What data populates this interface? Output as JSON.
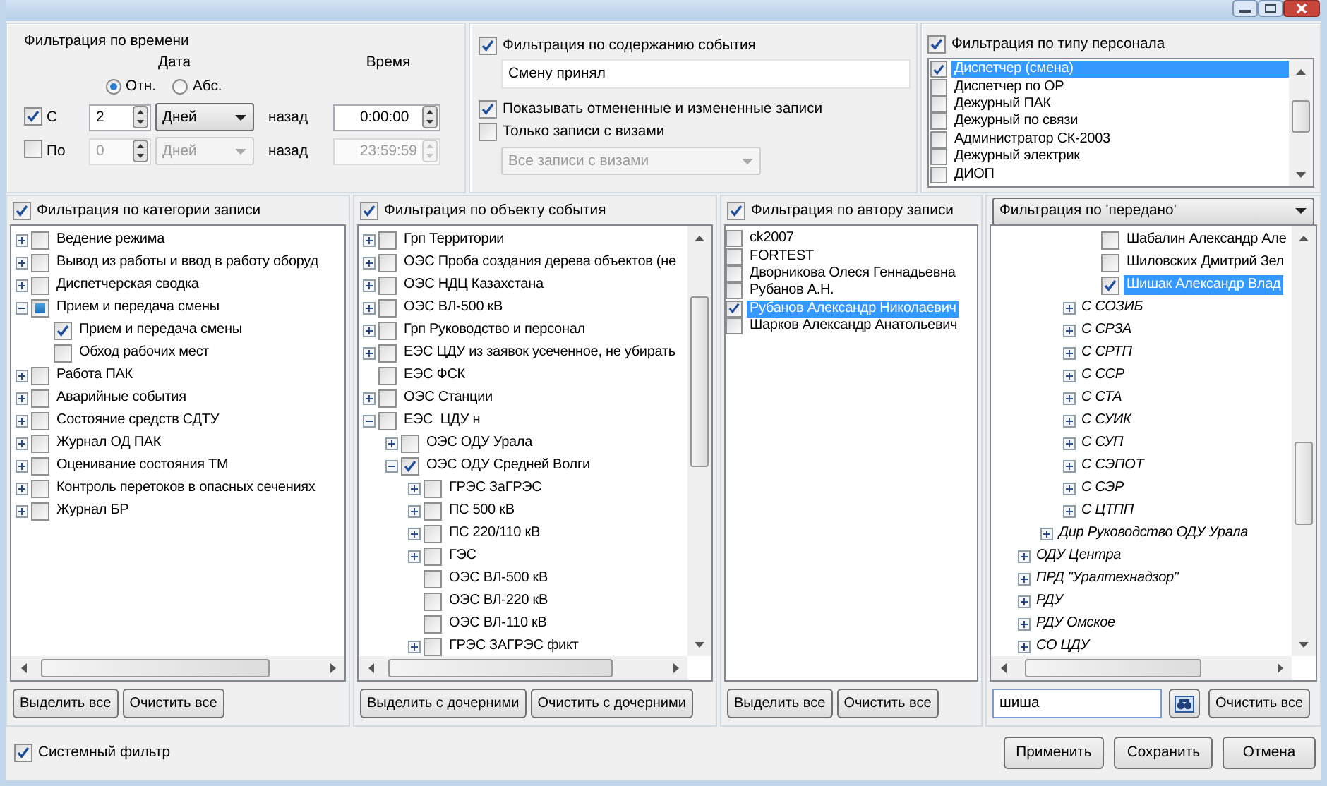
{
  "time_filter": {
    "title": "Фильтрация по времени",
    "date_heading": "Дата",
    "time_heading": "Время",
    "modes": [
      {
        "label": "Отн.",
        "selected": true
      },
      {
        "label": "Абс.",
        "selected": false
      }
    ],
    "rows": [
      {
        "label": "С",
        "checked": true,
        "count": "2",
        "unit": "Дней",
        "suffix": "назад",
        "time": "0:00:00",
        "disabled": false
      },
      {
        "label": "По",
        "checked": false,
        "count": "0",
        "unit": "Дней",
        "suffix": "назад",
        "time": "23:59:59",
        "disabled": true
      }
    ]
  },
  "content_filter": {
    "label": "Фильтрация по содержанию события",
    "checked": true,
    "text": "Смену принял",
    "options": [
      {
        "label": "Показывать отмененные и измененные записи",
        "checked": true
      },
      {
        "label": "Только записи с визами",
        "checked": false
      }
    ],
    "visa_select": {
      "value": "Все записи с визами",
      "disabled": true
    }
  },
  "personnel_filter": {
    "label": "Фильтрация по типу персонала",
    "checked": true,
    "items": [
      {
        "label": "Диспетчер (смена)",
        "checked": true,
        "selected": true
      },
      {
        "label": "Диспетчер по ОР",
        "checked": false,
        "selected": false
      },
      {
        "label": "Дежурный ПАК",
        "checked": false,
        "selected": false
      },
      {
        "label": "Дежурный по связи",
        "checked": false,
        "selected": false
      },
      {
        "label": "Администратор СК-2003",
        "checked": false,
        "selected": false
      },
      {
        "label": "Дежурный электрик",
        "checked": false,
        "selected": false
      },
      {
        "label": "ДИОП",
        "checked": false,
        "selected": false
      }
    ]
  },
  "panels": [
    {
      "kind": "tree",
      "label": "Фильтрация по категории записи",
      "checked": true,
      "nodes": [
        {
          "label": "Ведение режима",
          "kind": "branch",
          "expanded": false,
          "checked": false,
          "partial": false
        },
        {
          "label": "Вывод из работы и ввод в работу оборуд",
          "kind": "branch",
          "expanded": false,
          "checked": false,
          "partial": false
        },
        {
          "label": "Диспетчерская сводка",
          "kind": "branch",
          "expanded": false,
          "checked": false,
          "partial": false
        },
        {
          "label": "Прием и передача смены",
          "kind": "branch",
          "expanded": true,
          "checked": false,
          "partial": true,
          "children": [
            {
              "label": "Прием и передача смены",
              "kind": "leaf",
              "checked": true,
              "partial": false
            },
            {
              "label": "Обход рабочих мест",
              "kind": "leaf",
              "checked": false,
              "partial": false
            }
          ]
        },
        {
          "label": "Работа ПАК",
          "kind": "branch",
          "expanded": false,
          "checked": false,
          "partial": false
        },
        {
          "label": "Аварийные события",
          "kind": "branch",
          "expanded": false,
          "checked": false,
          "partial": false
        },
        {
          "label": "Состояние средств СДТУ",
          "kind": "branch",
          "expanded": false,
          "checked": false,
          "partial": false
        },
        {
          "label": "Журнал ОД ПАК",
          "kind": "branch",
          "expanded": false,
          "checked": false,
          "partial": false
        },
        {
          "label": "Оценивание состояния ТМ",
          "kind": "branch",
          "expanded": false,
          "checked": false,
          "partial": false
        },
        {
          "label": "Контроль перетоков в опасных сечениях",
          "kind": "branch",
          "expanded": false,
          "checked": false,
          "partial": false
        },
        {
          "label": "Журнал БР",
          "kind": "branch",
          "expanded": false,
          "checked": false,
          "partial": false
        }
      ],
      "buttons": [
        "Выделить все",
        "Очистить все"
      ]
    },
    {
      "kind": "tree",
      "label": "Фильтрация по объекту события",
      "checked": true,
      "nodes": [
        {
          "label": "Грп Территории",
          "kind": "branch",
          "expanded": false,
          "checked": false,
          "partial": false
        },
        {
          "label": "ОЭС Проба создания дерева объектов (не",
          "kind": "branch",
          "expanded": false,
          "checked": false,
          "partial": false
        },
        {
          "label": "ОЭС НДЦ Казахстана",
          "kind": "branch",
          "expanded": false,
          "checked": false,
          "partial": false
        },
        {
          "label": "ОЭС ВЛ-500 кВ",
          "kind": "branch",
          "expanded": false,
          "checked": false,
          "partial": false
        },
        {
          "label": "Грп Руководство и персонал",
          "kind": "branch",
          "expanded": false,
          "checked": false,
          "partial": false
        },
        {
          "label": "ЕЭС ЦДУ из заявок усеченное, не убирать",
          "kind": "branch",
          "expanded": false,
          "checked": false,
          "partial": false
        },
        {
          "label": "ЕЭС ФСК",
          "kind": "leaf",
          "checked": false,
          "partial": false
        },
        {
          "label": "ОЭС Станции",
          "kind": "branch",
          "expanded": false,
          "checked": false,
          "partial": false
        },
        {
          "label": "ЕЭС  ЦДУ н",
          "kind": "branch",
          "expanded": true,
          "checked": false,
          "partial": false,
          "children": [
            {
              "label": "ОЭС ОДУ Урала",
              "kind": "branch",
              "expanded": false,
              "checked": false,
              "partial": false
            },
            {
              "label": "ОЭС ОДУ Средней Волги",
              "kind": "branch",
              "expanded": true,
              "checked": true,
              "partial": false,
              "children": [
                {
                  "label": "ГРЭС ЗаГРЭС",
                  "kind": "branch",
                  "expanded": false,
                  "checked": false,
                  "partial": false
                },
                {
                  "label": "ПС 500 кВ",
                  "kind": "branch",
                  "expanded": false,
                  "checked": false,
                  "partial": false
                },
                {
                  "label": "ПС 220/110 кВ",
                  "kind": "branch",
                  "expanded": false,
                  "checked": false,
                  "partial": false
                },
                {
                  "label": "ГЭС",
                  "kind": "branch",
                  "expanded": false,
                  "checked": false,
                  "partial": false
                },
                {
                  "label": "ОЭС ВЛ-500 кВ",
                  "kind": "leaf",
                  "checked": false,
                  "partial": false
                },
                {
                  "label": "ОЭС ВЛ-220 кВ",
                  "kind": "leaf",
                  "checked": false,
                  "partial": false
                },
                {
                  "label": "ОЭС ВЛ-110 кВ",
                  "kind": "leaf",
                  "checked": false,
                  "partial": false
                },
                {
                  "label": "ГРЭС ЗАГРЭС фикт",
                  "kind": "branch",
                  "expanded": false,
                  "checked": false,
                  "partial": false
                }
              ]
            }
          ]
        }
      ],
      "buttons": [
        "Выделить с дочерними",
        "Очистить с дочерними"
      ]
    },
    {
      "kind": "list",
      "label": "Фильтрация по автору записи",
      "checked": true,
      "items": [
        {
          "label": "ck2007",
          "checked": false,
          "selected": false
        },
        {
          "label": "FORTEST",
          "checked": false,
          "selected": false
        },
        {
          "label": "Дворникова Олеся Геннадьевна",
          "checked": false,
          "selected": false
        },
        {
          "label": "Рубанов А.Н.",
          "checked": false,
          "selected": false
        },
        {
          "label": "Рубанов Александр Николаевич",
          "checked": true,
          "selected": true
        },
        {
          "label": "Шарков Александр Анатольевич",
          "checked": false,
          "selected": false
        }
      ],
      "buttons": [
        "Выделить все",
        "Очистить все"
      ]
    },
    {
      "kind": "tree",
      "selector": "Фильтрация по 'передано'",
      "nodes": [
        {
          "kind": "continued",
          "children": [
            {
              "kind": "continued",
              "children": [
                {
                  "kind": "continued",
                  "children": [
                    {
                      "kind": "continued",
                      "children": [
                        {
                          "label": "Шабалин Александр Але",
                          "kind": "leaf",
                          "checked": false,
                          "partial": false,
                          "selected": false
                        },
                        {
                          "label": "Шиловских Дмитрий Зел",
                          "kind": "leaf",
                          "checked": false,
                          "partial": false,
                          "selected": false
                        },
                        {
                          "label": "Шишак Александр Влад",
                          "kind": "leaf",
                          "checked": true,
                          "partial": false,
                          "selected": true
                        }
                      ]
                    },
                    {
                      "label": "С СОЗИБ",
                      "kind": "branch",
                      "expanded": false
                    },
                    {
                      "label": "С СРЗА",
                      "kind": "branch",
                      "expanded": false
                    },
                    {
                      "label": "С СРТП",
                      "kind": "branch",
                      "expanded": false
                    },
                    {
                      "label": "С ССР",
                      "kind": "branch",
                      "expanded": false
                    },
                    {
                      "label": "С СТА",
                      "kind": "branch",
                      "expanded": false
                    },
                    {
                      "label": "С СУИК",
                      "kind": "branch",
                      "expanded": false
                    },
                    {
                      "label": "С СУП",
                      "kind": "branch",
                      "expanded": false
                    },
                    {
                      "label": "С СЭПОТ",
                      "kind": "branch",
                      "expanded": false
                    },
                    {
                      "label": "С СЭР",
                      "kind": "branch",
                      "expanded": false
                    },
                    {
                      "label": "С ЦТПП",
                      "kind": "branch",
                      "expanded": false
                    }
                  ]
                },
                {
                  "label": "Дир Руководство ОДУ Урала",
                  "kind": "branch",
                  "expanded": false
                }
              ]
            },
            {
              "label": "ОДУ Центра",
              "kind": "branch",
              "expanded": false
            },
            {
              "label": "ПРД \"Уралтехнадзор\"",
              "kind": "branch",
              "expanded": false
            },
            {
              "label": "РДУ",
              "kind": "branch",
              "expanded": false
            },
            {
              "label": "РДУ Омское",
              "kind": "branch",
              "expanded": false
            },
            {
              "label": "СО ЦДУ",
              "kind": "branch",
              "expanded": false
            }
          ]
        }
      ],
      "search": {
        "value": "шиша"
      },
      "buttons": [
        "Очистить все"
      ]
    }
  ],
  "system_filter": {
    "label": "Системный фильтр",
    "checked": true
  },
  "buttons": [
    "Применить",
    "Сохранить",
    "Отмена"
  ]
}
